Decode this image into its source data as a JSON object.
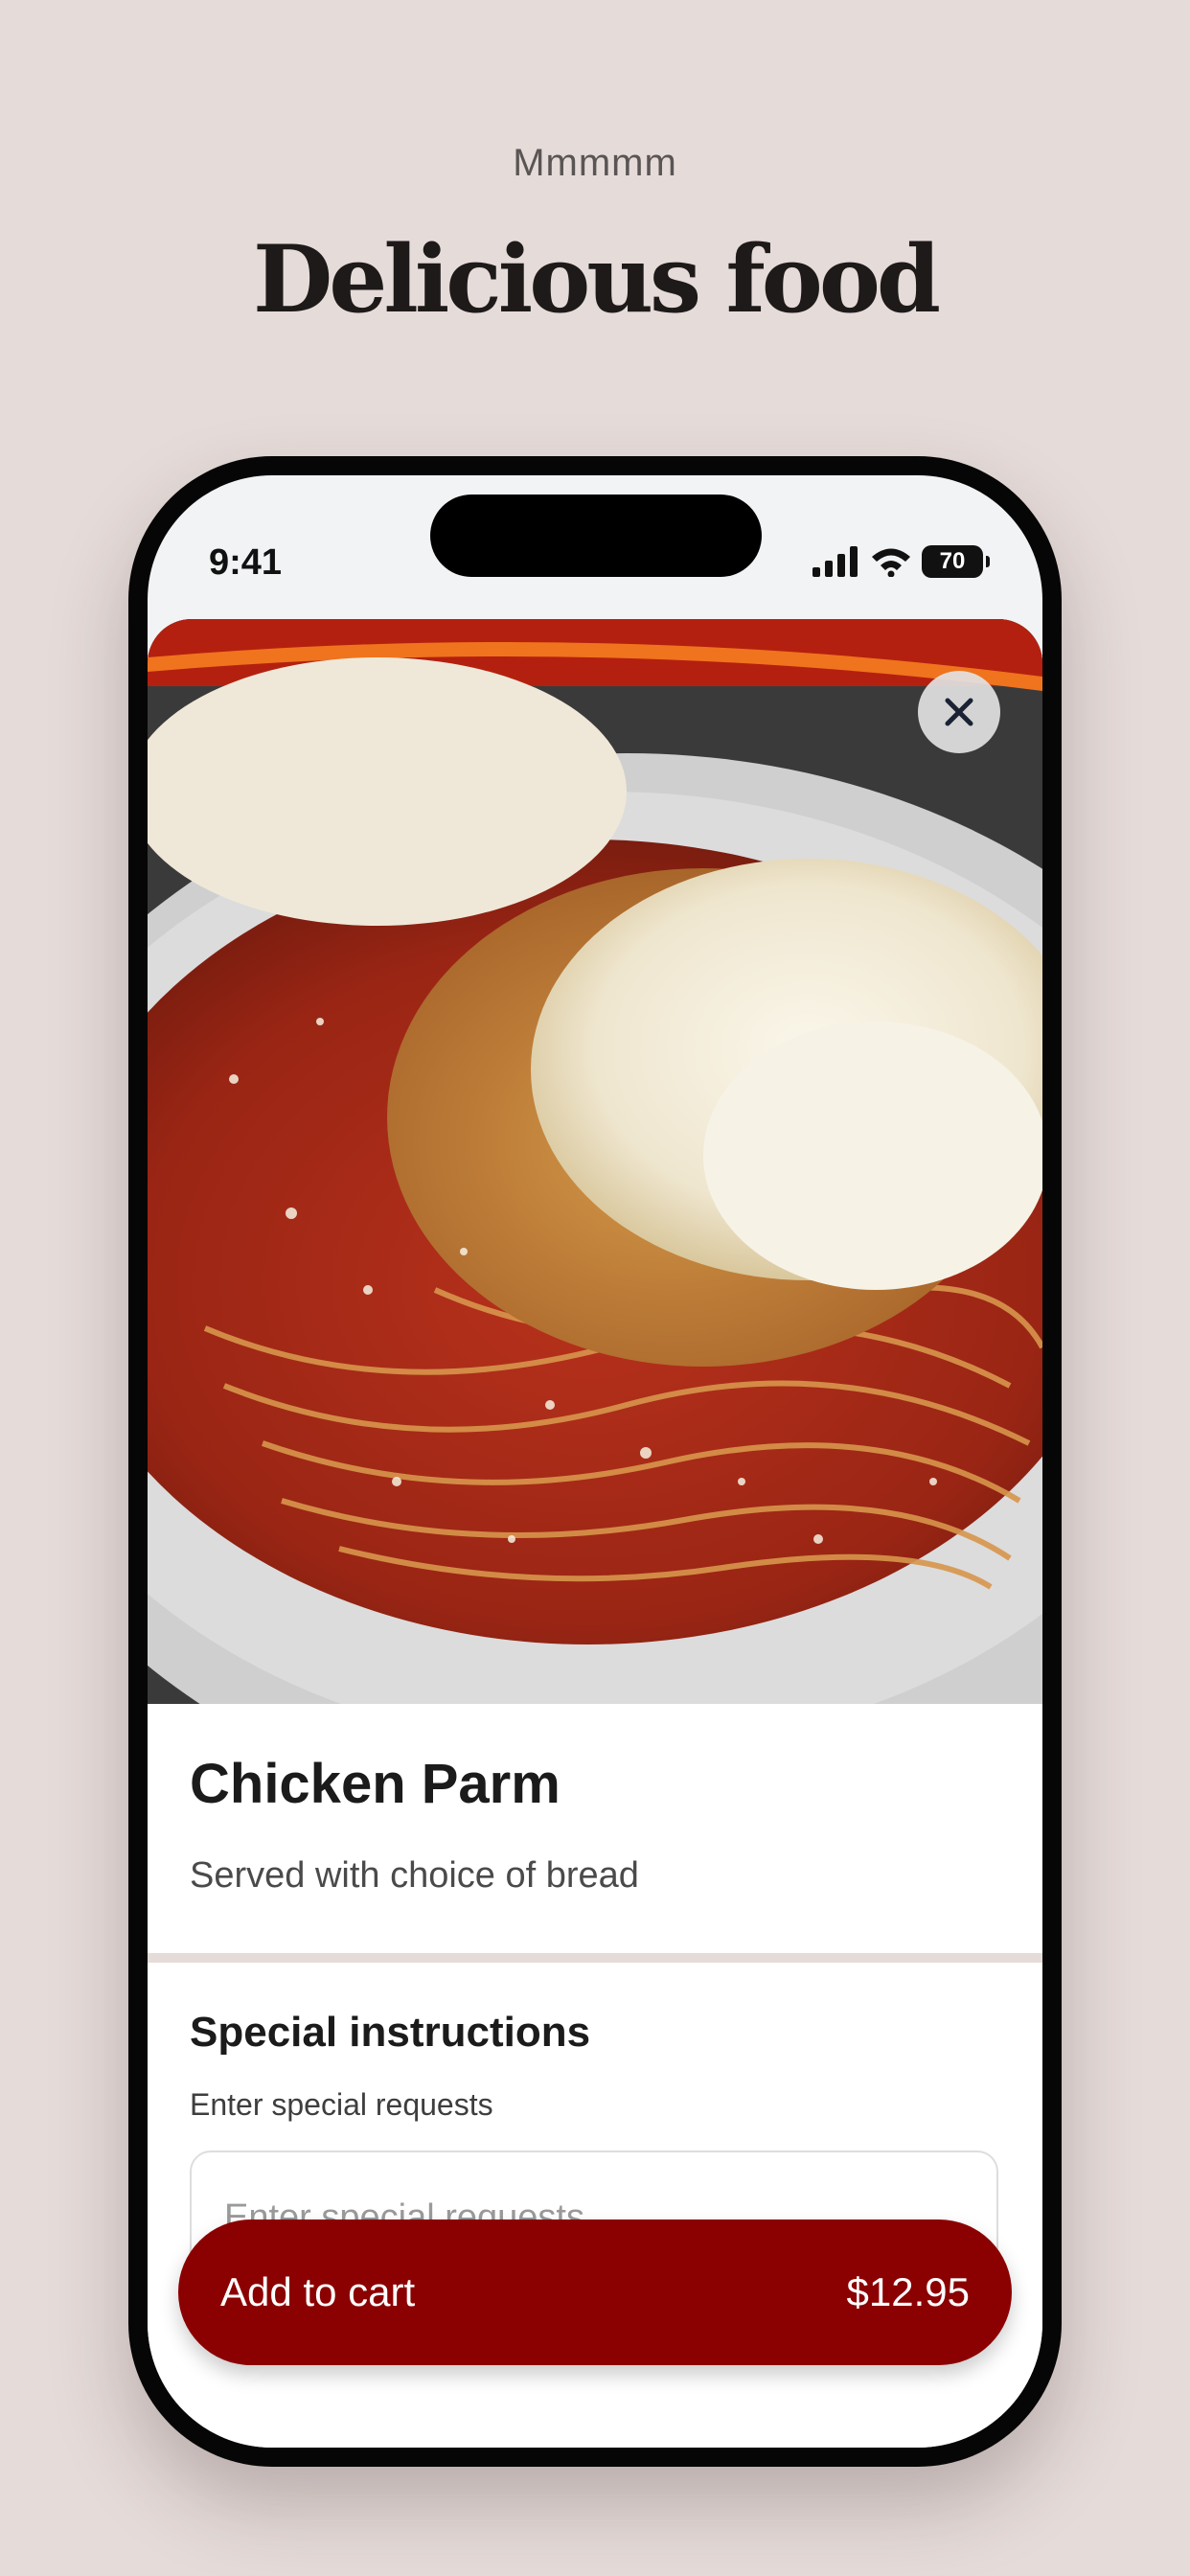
{
  "promo": {
    "eyebrow": "Mmmmm",
    "headline": "Delicious food"
  },
  "status_bar": {
    "time": "9:41",
    "battery": "70",
    "icons": [
      "signal-icon",
      "wifi-icon",
      "battery-icon"
    ]
  },
  "item": {
    "image": "chicken-parm-photo",
    "title": "Chicken Parm",
    "description": "Served with choice of bread"
  },
  "special_instructions": {
    "title": "Special instructions",
    "subtitle": "Enter special requests",
    "placeholder": "Enter special requests",
    "value": ""
  },
  "cart_button": {
    "label": "Add to cart",
    "price": "$12.95"
  },
  "colors": {
    "background": "#e5dbd9",
    "accent": "#8b0000"
  }
}
